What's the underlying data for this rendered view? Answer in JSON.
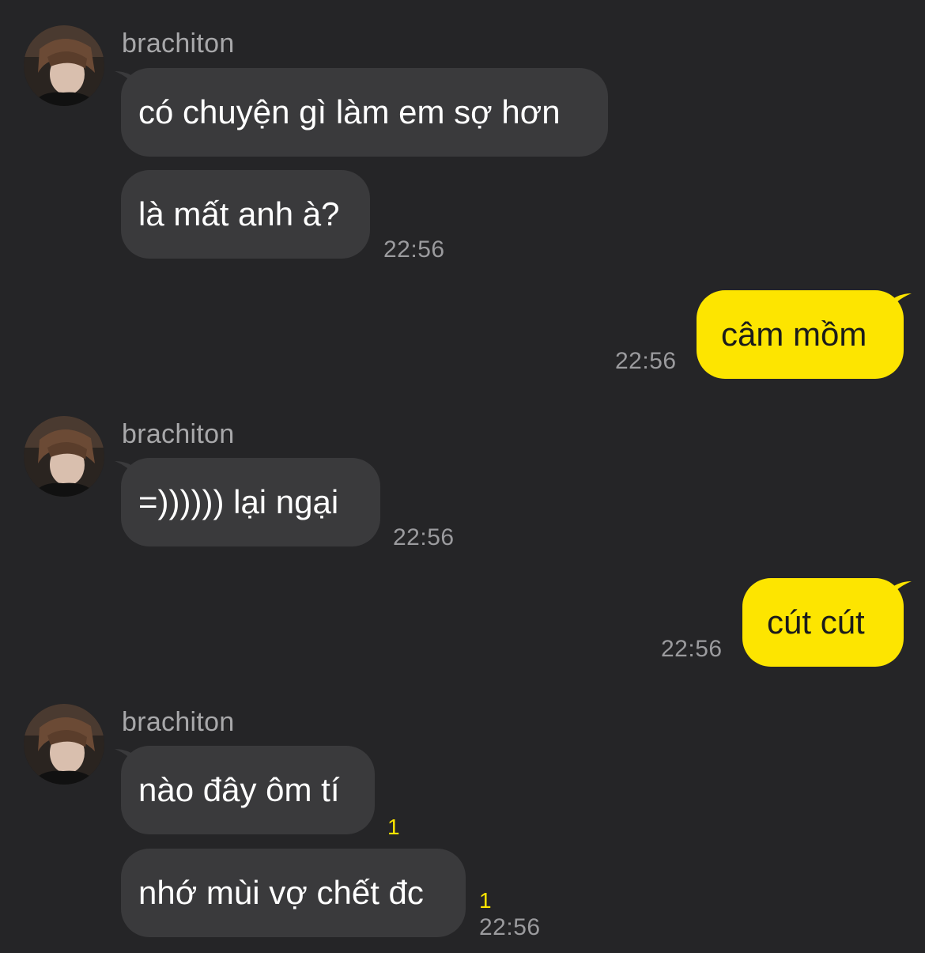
{
  "conversation": {
    "contact_name": "brachiton",
    "colors": {
      "background": "#252527",
      "incoming_bubble": "#3a3a3c",
      "outgoing_bubble": "#fde500",
      "timestamp": "#9b9b9e",
      "unread_count": "#fde500"
    },
    "messages": [
      {
        "direction": "incoming",
        "sender": "brachiton",
        "text": "có chuyện gì làm em sợ hơn"
      },
      {
        "direction": "incoming",
        "text": "là mất anh à?",
        "time": "22:56"
      },
      {
        "direction": "outgoing",
        "text": "câm mồm",
        "time": "22:56"
      },
      {
        "direction": "incoming",
        "sender": "brachiton",
        "text": "=)))))) lại ngại",
        "time": "22:56"
      },
      {
        "direction": "outgoing",
        "text": "cút cút",
        "time": "22:56"
      },
      {
        "direction": "incoming",
        "sender": "brachiton",
        "text": "nào đây ôm tí",
        "unread": "1"
      },
      {
        "direction": "incoming",
        "text": "nhớ mùi vợ chết đc",
        "unread": "1",
        "time": "22:56"
      }
    ]
  }
}
